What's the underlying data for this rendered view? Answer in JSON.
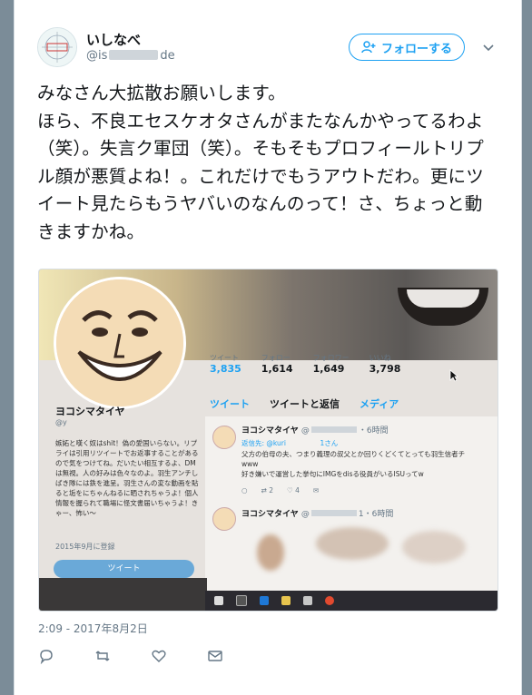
{
  "user": {
    "display_name": "いしなべ",
    "handle_prefix": "@is",
    "handle_suffix": "de",
    "avatar_icon": "profile-avatar"
  },
  "follow_button": {
    "label": "フォローする",
    "icon": "add-user-icon"
  },
  "menu_caret": {
    "icon": "chevron-down-icon"
  },
  "tweet": {
    "text": "みなさん大拡散お願いします。\nほら、不良エセスケオタさんがまたなんかやってるわよ（笑）。失言ク軍団（笑）。そもそもプロフィールトリプル顔が悪質よね！。これだけでもうアウトだわ。更にツイート見たらもうヤバいのなんのって！さ、ちょっと動きますかね。",
    "timestamp": "2:09 - 2017年8月2日"
  },
  "embedded_photo": {
    "stats": [
      {
        "label": "ツイート",
        "value": "3,835"
      },
      {
        "label": "フォロー",
        "value": "1,614"
      },
      {
        "label": "フォロワー",
        "value": "1,649"
      },
      {
        "label": "いいね",
        "value": "3,798"
      }
    ],
    "tabs": [
      "ツイート",
      "ツイートと返信",
      "メディア"
    ],
    "profile_name": "ヨコシマタイヤ",
    "profile_handle": "@y",
    "bio": "嫉妬と嘆く奴はshit！偽の愛国いらない。リプライは引用リツイートでお返事することがあるので気をつけてね。だいたい相互するよ、DMは無視。人の好みは色々なのよ。羽生アンチしばき隊には鉄を進呈。羽生さんの変な動画を貼ると垢をにちゃんねるに晒されちゃうよ！個人情報を握られて職場に怪文書届いちゃうよ！きゃー、怖い〜",
    "joined": "2015年9月に登録",
    "tweet_button": "ツイート",
    "feed": [
      {
        "name": "ヨコシマタイヤ",
        "handle": "@",
        "time": "・6時間",
        "reply_to": "返信先: @kuri　　　　　1さん",
        "line1": "父方の伯母の夫、つまり義理の叔父とか回りくどくてとっても羽生信者チ",
        "line2": "www",
        "line3": "好き嫌いで運営した挙句にIMGをdisる役員がいるISUってw",
        "retweets": "2",
        "likes": "4"
      },
      {
        "name": "ヨコシマタイヤ",
        "handle": "@",
        "time": "1・6時間"
      }
    ]
  },
  "actions": [
    {
      "name": "reply-icon"
    },
    {
      "name": "retweet-icon"
    },
    {
      "name": "like-icon"
    },
    {
      "name": "message-icon"
    }
  ]
}
